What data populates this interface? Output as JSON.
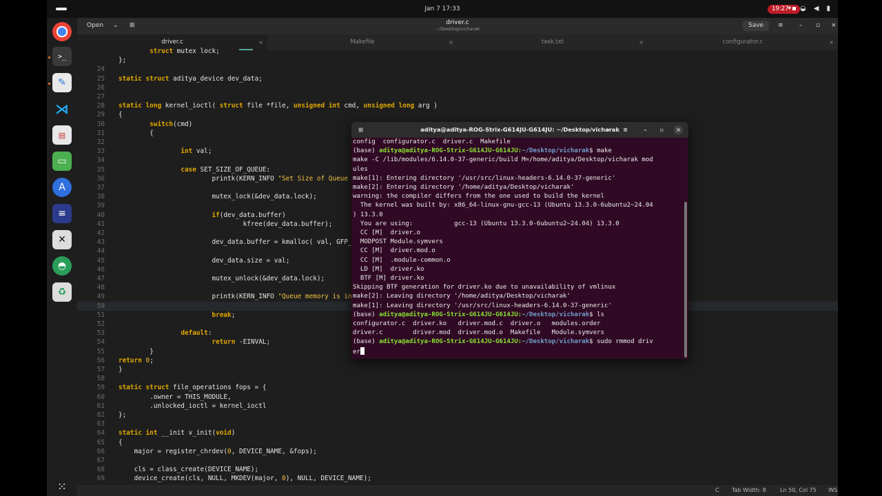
{
  "topbar": {
    "clock": "Jan 7  17:33",
    "recording": "19:27"
  },
  "editor": {
    "open_label": "Open",
    "title": "driver.c",
    "subtitle": "~/Desktop/vicharak",
    "save_label": "Save",
    "tabs": [
      {
        "label": "driver.c"
      },
      {
        "label": "Makefile"
      },
      {
        "label": "task.txt"
      },
      {
        "label": "configurator.c"
      }
    ],
    "code_lines": [
      {
        "n": "",
        "t": "        struct mutex lock;"
      },
      {
        "n": "",
        "t": "};"
      },
      {
        "n": "24",
        "t": ""
      },
      {
        "n": "25",
        "t": "static struct aditya_device dev_data;"
      },
      {
        "n": "26",
        "t": ""
      },
      {
        "n": "27",
        "t": ""
      },
      {
        "n": "28",
        "t": "static long kernel_ioctl( struct file *file, unsigned int cmd, unsigned long arg )"
      },
      {
        "n": "29",
        "t": "{"
      },
      {
        "n": "30",
        "t": "        switch(cmd)"
      },
      {
        "n": "31",
        "t": "        {"
      },
      {
        "n": "32",
        "t": ""
      },
      {
        "n": "33",
        "t": "                int val;"
      },
      {
        "n": "34",
        "t": ""
      },
      {
        "n": "35",
        "t": "                case SET_SIZE_OF_QUEUE:"
      },
      {
        "n": "36",
        "t": "                        printk(KERN_INFO \"Set Size of Queue comm"
      },
      {
        "n": "37",
        "t": ""
      },
      {
        "n": "38",
        "t": "                        mutex_lock(&dev_data.lock);"
      },
      {
        "n": "39",
        "t": ""
      },
      {
        "n": "40",
        "t": "                        if(dev_data.buffer)"
      },
      {
        "n": "41",
        "t": "                                kfree(dev_data.buffer);"
      },
      {
        "n": "42",
        "t": ""
      },
      {
        "n": "43",
        "t": "                        dev_data.buffer = kmalloc( val, GFP_KERN"
      },
      {
        "n": "44",
        "t": ""
      },
      {
        "n": "45",
        "t": "                        dev_data.size = val;"
      },
      {
        "n": "46",
        "t": ""
      },
      {
        "n": "47",
        "t": "                        mutex_unlock(&dev_data.lock);"
      },
      {
        "n": "48",
        "t": ""
      },
      {
        "n": "49",
        "t": "                        printk(KERN_INFO \"Queue memory is initia"
      },
      {
        "n": "50",
        "t": ""
      },
      {
        "n": "51",
        "t": "                        break;"
      },
      {
        "n": "52",
        "t": ""
      },
      {
        "n": "53",
        "t": "                default:"
      },
      {
        "n": "54",
        "t": "                        return -EINVAL;"
      },
      {
        "n": "55",
        "t": "        }"
      },
      {
        "n": "56",
        "t": "return 0;"
      },
      {
        "n": "57",
        "t": "}"
      },
      {
        "n": "58",
        "t": ""
      },
      {
        "n": "59",
        "t": "static struct file_operations fops = {"
      },
      {
        "n": "60",
        "t": "        .owner = THIS_MODULE,"
      },
      {
        "n": "61",
        "t": "        .unlocked_ioctl = kernel_ioctl"
      },
      {
        "n": "62",
        "t": "};"
      },
      {
        "n": "63",
        "t": ""
      },
      {
        "n": "64",
        "t": "static int __init v_init(void)"
      },
      {
        "n": "65",
        "t": "{"
      },
      {
        "n": "66",
        "t": "    major = register_chrdev(0, DEVICE_NAME, &fops);"
      },
      {
        "n": "67",
        "t": ""
      },
      {
        "n": "68",
        "t": "    cls = class_create(DEVICE_NAME);"
      },
      {
        "n": "69",
        "t": "    device_create(cls, NULL, MKDEV(major, 0), NULL, DEVICE_NAME);"
      }
    ],
    "status": {
      "lang": "C",
      "tab_width": "Tab Width: 8",
      "position": "Ln 50, Col 75",
      "mode": "INS"
    }
  },
  "terminal": {
    "title": "aditya@aditya-ROG-Strix-G614JU-G614JU: ~/Desktop/vicharak",
    "lines": [
      {
        "t": "config  configurator.c  driver.c  Makefile"
      },
      {
        "pre": "(base) ",
        "user": "aditya@aditya-ROG-Strix-G614JU-G614JU:",
        "path": "~/Desktop/vicharak",
        "cmd": "$ make"
      },
      {
        "t": "make -C /lib/modules/6.14.0-37-generic/build M=/home/aditya/Desktop/vicharak mod"
      },
      {
        "t": "ules"
      },
      {
        "t": "make[1]: Entering directory '/usr/src/linux-headers-6.14.0-37-generic'"
      },
      {
        "t": "make[2]: Entering directory '/home/aditya/Desktop/vicharak'"
      },
      {
        "t": "warning: the compiler differs from the one used to build the kernel"
      },
      {
        "t": "  The kernel was built by: x86_64-linux-gnu-gcc-13 (Ubuntu 13.3.0-6ubuntu2~24.04"
      },
      {
        "t": ") 13.3.0"
      },
      {
        "t": "  You are using:           gcc-13 (Ubuntu 13.3.0-6ubuntu2~24.04) 13.3.0"
      },
      {
        "t": "  CC [M]  driver.o"
      },
      {
        "t": "  MODPOST Module.symvers"
      },
      {
        "t": "  CC [M]  driver.mod.o"
      },
      {
        "t": "  CC [M]  .module-common.o"
      },
      {
        "t": "  LD [M]  driver.ko"
      },
      {
        "t": "  BTF [M] driver.ko"
      },
      {
        "t": "Skipping BTF generation for driver.ko due to unavailability of vmlinux"
      },
      {
        "t": "make[2]: Leaving directory '/home/aditya/Desktop/vicharak'"
      },
      {
        "t": "make[1]: Leaving directory '/usr/src/linux-headers-6.14.0-37-generic'"
      },
      {
        "pre": "(base) ",
        "user": "aditya@aditya-ROG-Strix-G614JU-G614JU:",
        "path": "~/Desktop/vicharak",
        "cmd": "$ ls"
      },
      {
        "t": "configurator.c  driver.ko   driver.mod.c  driver.o   modules.order"
      },
      {
        "t": "driver.c        driver.mod  driver.mod.o  Makefile   Module.symvers"
      },
      {
        "pre": "(base) ",
        "user": "aditya@aditya-ROG-Strix-G614JU-G614JU:",
        "path": "~/Desktop/vicharak",
        "cmd": "$ sudo rmmod driv"
      },
      {
        "t": "er",
        "cursor": true
      }
    ]
  },
  "colors": {
    "terminal_bg": "#300a24",
    "prompt_user": "#8ae234",
    "prompt_path": "#729fcf",
    "keyword": "#e0a800"
  }
}
